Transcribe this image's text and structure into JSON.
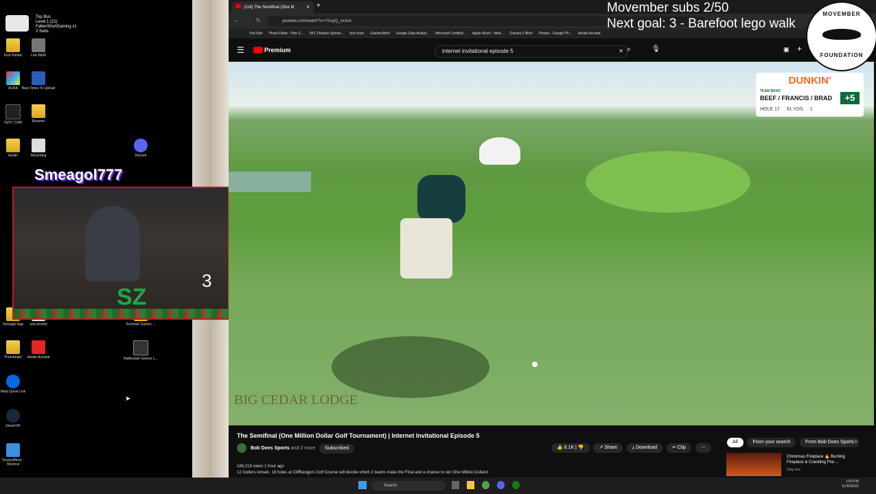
{
  "overlay": {
    "line1": "Movember subs 2/50",
    "line2": "Next goal: 3 - Barefoot lego walk",
    "badge_top": "MOVEMBER",
    "badge_bottom": "FOUNDATION",
    "streamer": "Smeagol777",
    "topbus": [
      "Top Bus",
      "Level 1 (21)",
      "FallenShortGaming x1",
      "2 Subs"
    ],
    "count": "3"
  },
  "desktop": {
    "icons": [
      {
        "label": "Kick Panels",
        "kind": "folder"
      },
      {
        "label": "Live B&W",
        "kind": "app"
      },
      {
        "label": "AURA",
        "kind": "app"
      },
      {
        "label": "Best Times To Upload",
        "kind": "doc"
      },
      {
        "label": "NZXT CAM",
        "kind": "app"
      },
      {
        "label": "Resume",
        "kind": "folder"
      },
      {
        "label": "Austin",
        "kind": "folder"
      },
      {
        "label": "Recording",
        "kind": "app"
      },
      {
        "label": "Discord",
        "kind": "app"
      },
      {
        "label": "Rockstar Games ...",
        "kind": "app"
      },
      {
        "label": "Smeagol logo",
        "kind": "folder"
      },
      {
        "label": "snd-sinshot",
        "kind": "app"
      },
      {
        "label": "Thumbnails",
        "kind": "folder"
      },
      {
        "label": "Adobe Acrobat",
        "kind": "app"
      },
      {
        "label": "Battlestate Games L...",
        "kind": "app"
      },
      {
        "label": "Meta Quest Link",
        "kind": "app"
      },
      {
        "label": "SteamVR",
        "kind": "app"
      },
      {
        "label": "OculusMirror - Shortcut",
        "kind": "app"
      }
    ]
  },
  "browser": {
    "tab_title": "(118) The Semifinal (One M",
    "url": "youtube.com/watch?v=YGuyQ_vxzeA",
    "bookmarks": [
      "YouTube",
      "Photo Editor : Pixlr E...",
      "NFL Position Spinne...",
      "kick tools",
      "Gamba Bitch",
      "Google Data Analyti...",
      "Microsoft Certified...",
      "Apple Music - Web...",
      "Gamba 2 Bitch",
      "Photos - Google Ph...",
      "Adobe Acrobat"
    ],
    "brand": "Premium",
    "search_query": "internet invitational episode 5"
  },
  "video": {
    "scoreboard": {
      "sponsor": "DUNKIN'",
      "team_label": "TEAM BRAD",
      "team": "BEEF / FRANCIS / BRAD",
      "score": "+5",
      "hole": "HOLE 17",
      "yards": "91 YDS",
      "shot": "1"
    },
    "watermark": "BIG CEDAR LODGE"
  },
  "page": {
    "title": "The Semifinal (One Million Dollar Golf Tournament) | Internet Invitational Episode 5",
    "channel": "Bob Does Sports",
    "channel_more": "and 2 more",
    "subscribed": "Subscribed",
    "likes": "8.1K",
    "share": "Share",
    "download": "Download",
    "clip": "Clip",
    "meta": "189,219 views  1 hour ago",
    "description": "12 Gollers remain. 18 holes at Cliffhangers Golf Course will decide which 2 teams make the Final and a chance to win One Million Dollars!",
    "chips": [
      "All",
      "From your search",
      "From Bob Does Sports"
    ],
    "rec_title": "Christmas Fireplace 🔥 Burning Fireplace & Crackling Fire ...",
    "rec_channel": "Only Fire"
  },
  "taskbar": {
    "search": "Search",
    "time": "1:50 PM",
    "date": "11/10/2023"
  },
  "colors": {
    "yt_red": "#ff0000",
    "dunkin_orange": "#ff671f",
    "dunkin_pink": "#da1884",
    "scoreboard_green": "#0d6b3a"
  }
}
